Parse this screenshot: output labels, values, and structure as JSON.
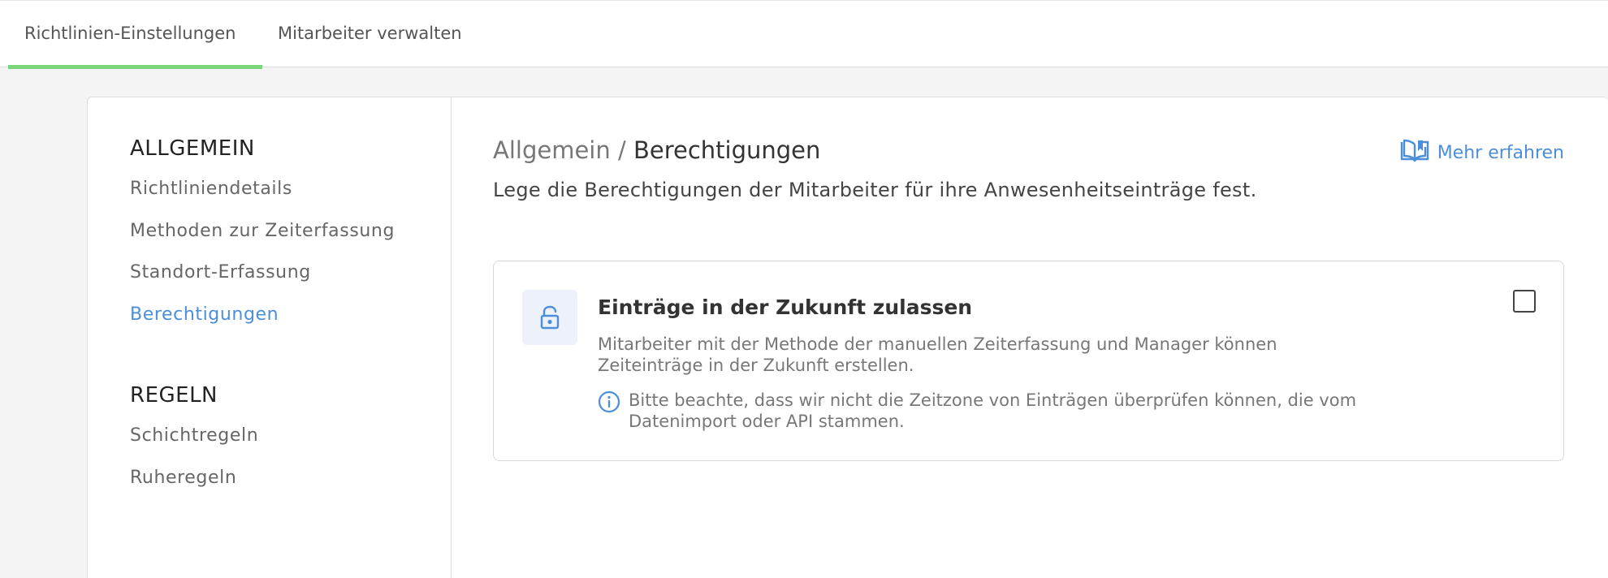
{
  "tabs": [
    {
      "label": "Richtlinien-Einstellungen",
      "active": true
    },
    {
      "label": "Mitarbeiter verwalten",
      "active": false
    }
  ],
  "sidebar": {
    "section1": {
      "heading": "ALLGEMEIN",
      "items": [
        "Richtliniendetails",
        "Methoden zur Zeiterfassung",
        "Standort-Erfassung",
        "Berechtigungen"
      ]
    },
    "section2": {
      "heading": "REGELN",
      "items": [
        "Schichtregeln",
        "Ruheregeln"
      ]
    },
    "active_item": "Berechtigungen"
  },
  "main": {
    "breadcrumb": {
      "parent": "Allgemein",
      "separator": "/",
      "current": "Berechtigungen"
    },
    "learn_more": "Mehr erfahren",
    "subtitle": "Lege die Berechtigungen der Mitarbeiter für ihre Anwesenheitseinträge fest.",
    "permission": {
      "title": "Einträge in der Zukunft zulassen",
      "description": "Mitarbeiter mit der Methode der manuellen Zeiterfassung und Manager können Zeiteinträge in der Zukunft erstellen.",
      "note": "Bitte beachte, dass wir nicht die Zeitzone von Einträgen überprüfen können, die vom Datenimport oder API stammen.",
      "checked": false
    }
  },
  "colors": {
    "accent": "#4d8edb",
    "tab_indicator": "#79d779",
    "background": "#f4f4f4"
  },
  "icons": {
    "learn_more": "book-open-icon",
    "permission": "lock-icon",
    "note": "info-icon"
  }
}
